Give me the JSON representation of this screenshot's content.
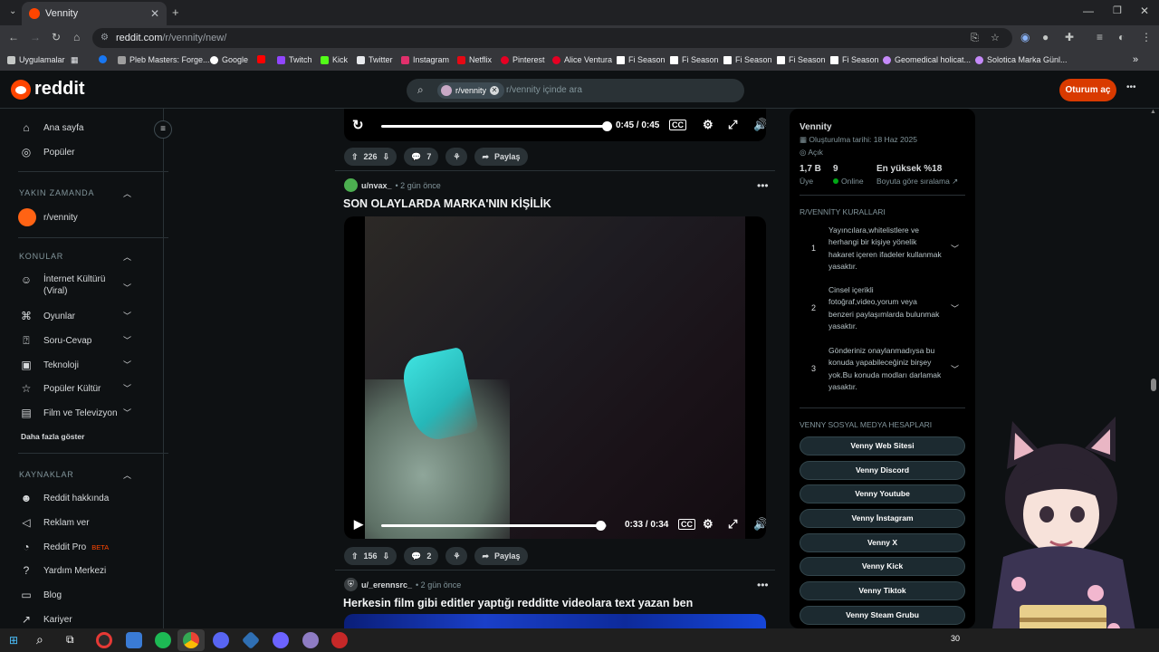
{
  "browser": {
    "tab_title": "Vennity",
    "url_host": "reddit.com",
    "url_path": "/r/vennity/new/",
    "bookmarks": [
      "Uygulamalar",
      "Pleb Masters: Forge...",
      "Google",
      "Twitch",
      "Kick",
      "Twitter",
      "Instagram",
      "Netflix",
      "Pinterest",
      "Alice Ventura",
      "Fi Season",
      "Fi Season",
      "Fi Season",
      "Fi Season",
      "Fi Season",
      "Geomedical holicat...",
      "Solotica Marka Günl..."
    ]
  },
  "header": {
    "logo_text": "reddit",
    "search_chip": "r/vennity",
    "search_placeholder": "r/vennity içinde ara",
    "login_label": "Oturum aç",
    "more_label": "•••"
  },
  "leftnav": {
    "home": "Ana sayfa",
    "popular": "Popüler",
    "recent_heading": "YAKIN ZAMANDA",
    "recent_item": "r/vennity",
    "topics_heading": "KONULAR",
    "topics": [
      "İnternet Kültürü (Viral)",
      "Oyunlar",
      "Soru-Cevap",
      "Teknoloji",
      "Popüler Kültür",
      "Film ve Televizyon"
    ],
    "show_more": "Daha fazla göster",
    "resources_heading": "KAYNAKLAR",
    "resources": [
      "Reddit hakkında",
      "Reklam ver",
      "Reddit Pro",
      "Yardım Merkezi",
      "Blog",
      "Kariyer"
    ],
    "beta_badge": "BETA"
  },
  "feed": {
    "post1": {
      "time": "0:45 / 0:45",
      "progress": 1.0,
      "upvotes": "226",
      "comments": "7",
      "share": "Paylaş"
    },
    "post2": {
      "user": "u/nvax_",
      "age": "• 2 gün önce",
      "title": "SON OLAYLARDA MARKA'NIN KİŞİLİK",
      "time": "0:33 / 0:34",
      "progress": 0.97,
      "upvotes": "156",
      "comments": "2",
      "share": "Paylaş"
    },
    "post3": {
      "user": "u/_erennsrc_",
      "age": "• 2 gün önce",
      "title": "Herkesin film gibi editler yaptığı redditte videolara text yazan ben"
    }
  },
  "sidebar": {
    "name": "Vennity",
    "created": "Oluşturulma tarihi: 18 Haz 2025",
    "visibility": "Açık",
    "members_value": "1,7 B",
    "members_label": "Üye",
    "online_value": "9",
    "online_label": "Online",
    "rank_value": "En yüksek %18",
    "rank_label": "Boyuta göre sıralama",
    "rules_heading": "R/VENNİTY KURALLARI",
    "rules": [
      {
        "num": "1",
        "text": "Yayıncılara,whitelistlere ve herhangi bir kişiye yönelik hakaret içeren ifadeler kullanmak yasaktır."
      },
      {
        "num": "2",
        "text": "Cinsel içerikli fotoğraf,video,yorum veya benzeri paylaşımlarda bulunmak yasaktır."
      },
      {
        "num": "3",
        "text": "Gönderiniz onaylanmadıysa bu konuda yapabileceğiniz birşey yok.Bu konuda modları darlamak yasaktır."
      }
    ],
    "social_heading": "VENNY SOSYAL MEDYA HESAPLARI",
    "social_buttons": [
      "Venny Web Sitesi",
      "Venny Discord",
      "Venny Youtube",
      "Venny İnstagram",
      "Venny X",
      "Venny Kick",
      "Venny Tiktok",
      "Venny Steam Grubu"
    ]
  },
  "taskbar": {
    "tray_text": "30"
  }
}
